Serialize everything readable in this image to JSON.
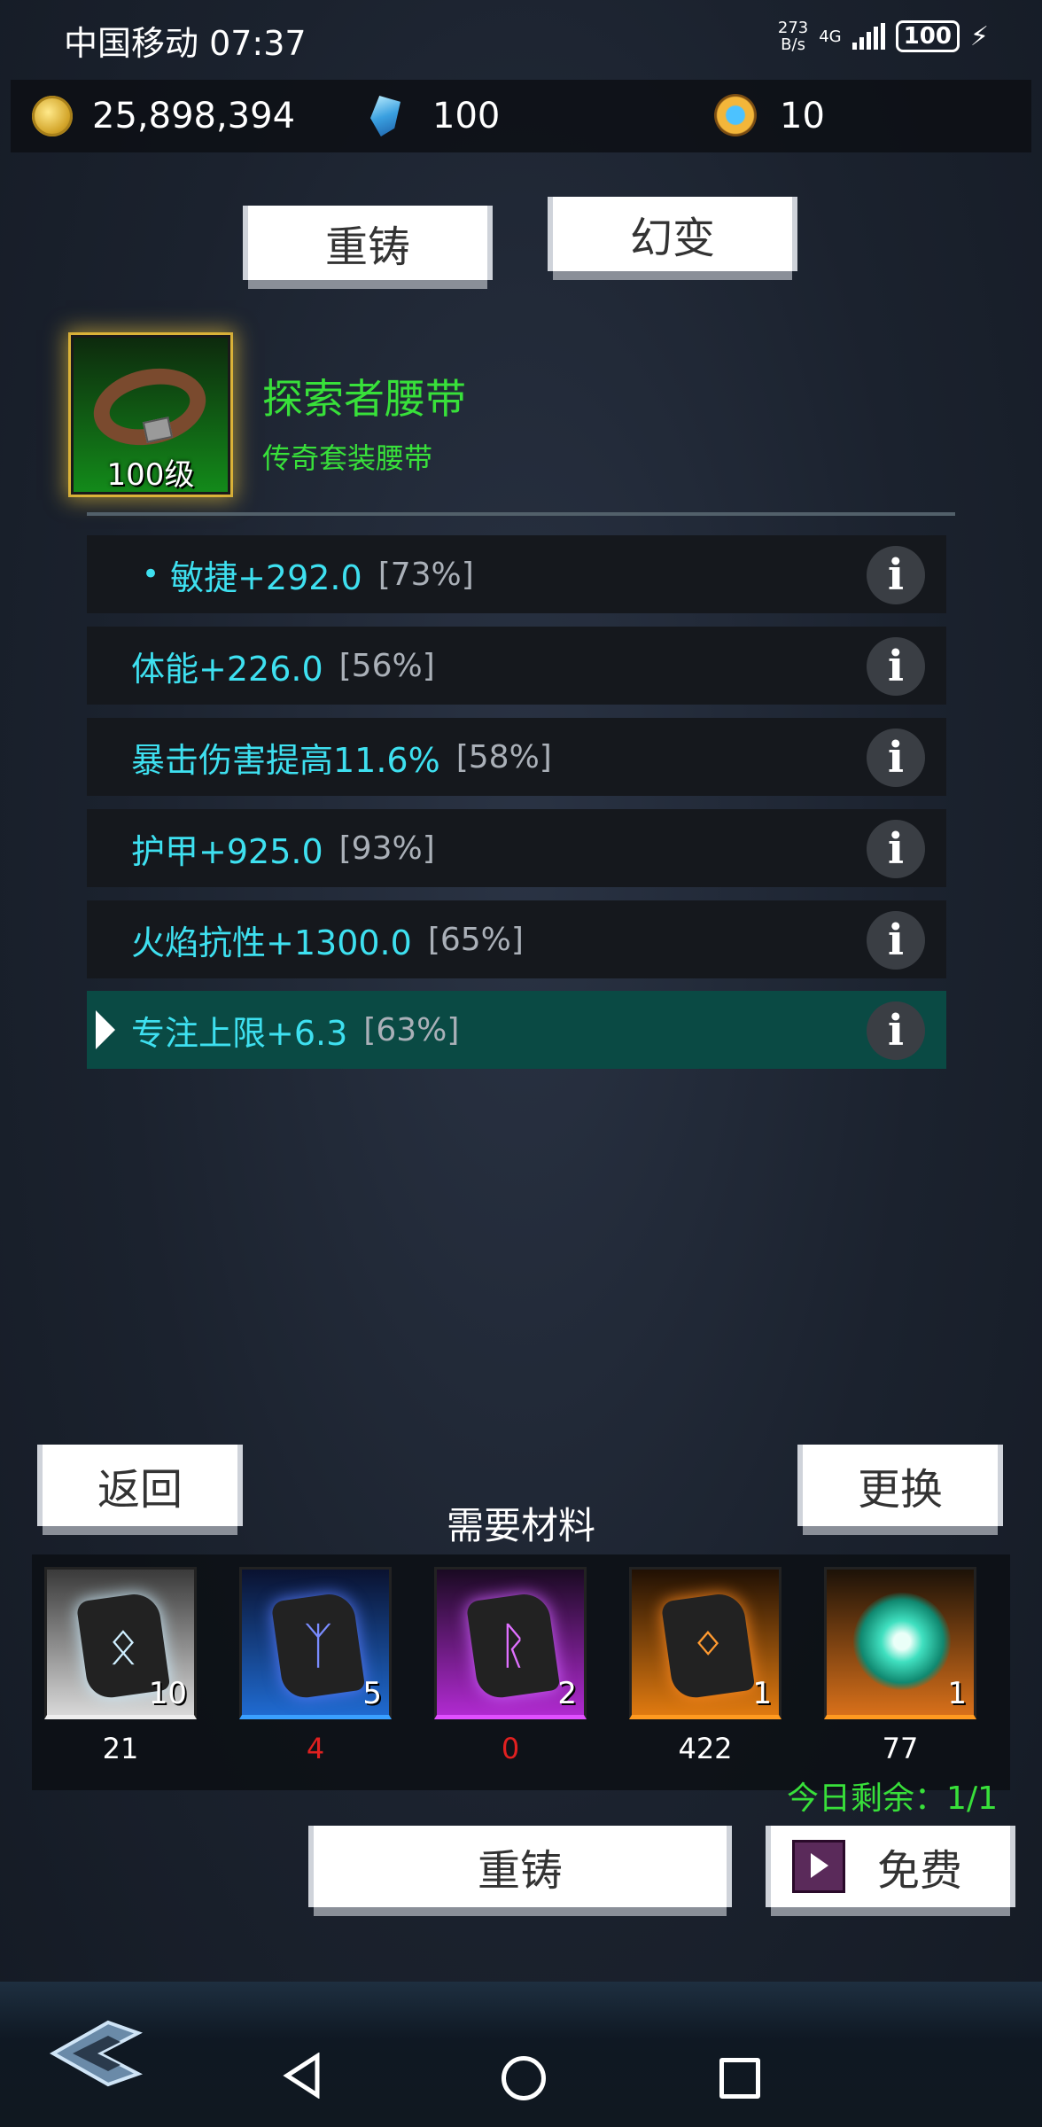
{
  "status_bar": {
    "carrier_time": "中国移动 07:37",
    "net_speed_value": "273",
    "net_speed_unit": "B/s",
    "network": "4G",
    "battery": "100"
  },
  "currency": {
    "gold": "25,898,394",
    "gems": "100",
    "orbs": "10"
  },
  "tabs": {
    "reforge": "重铸",
    "transmog": "幻变"
  },
  "item": {
    "level": "100级",
    "name": "探索者腰带",
    "type": "传奇套装腰带",
    "rarity_color": "#38e03a"
  },
  "stats": [
    {
      "text": "敏捷+292.0",
      "pct": "[73%]"
    },
    {
      "text": "体能+226.0",
      "pct": "[56%]"
    },
    {
      "text": "暴击伤害提高11.6%",
      "pct": "[58%]"
    },
    {
      "text": "护甲+925.0",
      "pct": "[93%]"
    },
    {
      "text": "火焰抗性+1300.0",
      "pct": "[65%]"
    },
    {
      "text": "专注上限+6.3",
      "pct": "[63%]"
    }
  ],
  "buttons": {
    "back": "返回",
    "change": "更换",
    "reforge": "重铸",
    "free": "免费"
  },
  "materials": {
    "title": "需要材料",
    "items": [
      {
        "required": "10",
        "owned": "21",
        "owned_color": "#ffffff"
      },
      {
        "required": "5",
        "owned": "4",
        "owned_color": "#e02020"
      },
      {
        "required": "2",
        "owned": "0",
        "owned_color": "#e02020"
      },
      {
        "required": "1",
        "owned": "422",
        "owned_color": "#ffffff"
      },
      {
        "required": "1",
        "owned": "77",
        "owned_color": "#ffffff"
      }
    ]
  },
  "daily_remaining": "今日剩余：1/1"
}
